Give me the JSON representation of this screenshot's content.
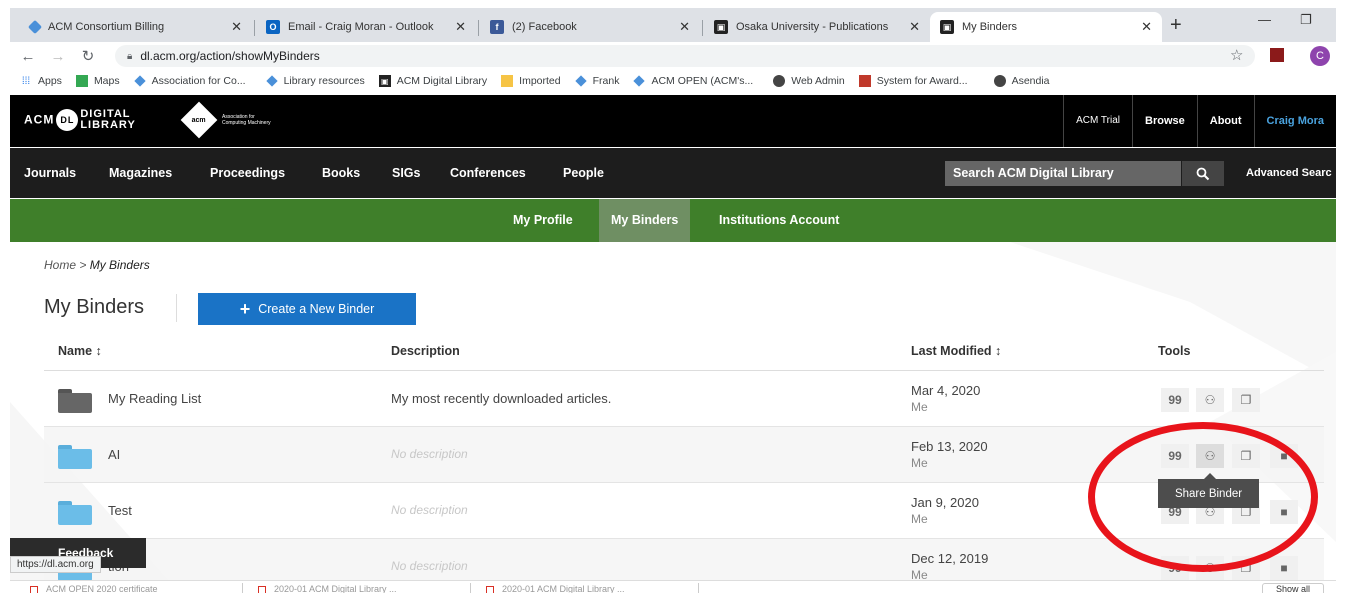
{
  "browser": {
    "tabs": [
      {
        "title": "ACM Consortium Billing",
        "icon": "acm-diamond-icon"
      },
      {
        "title": "Email - Craig Moran - Outlook",
        "icon": "outlook-icon"
      },
      {
        "title": "(2) Facebook",
        "icon": "facebook-icon"
      },
      {
        "title": "Osaka University - Publications",
        "icon": "acm-dl-icon"
      },
      {
        "title": "My Binders",
        "icon": "acm-dl-icon"
      }
    ],
    "active_tab": 4,
    "url": "dl.acm.org/action/showMyBinders",
    "profile_initial": "C",
    "bookmarks": [
      {
        "label": "Apps",
        "icon": "apps-grid-icon"
      },
      {
        "label": "Maps",
        "icon": "maps-icon"
      },
      {
        "label": "Association for Co...",
        "icon": "acm-diamond-icon"
      },
      {
        "label": "Library resources",
        "icon": "acm-diamond-icon"
      },
      {
        "label": "ACM Digital Library",
        "icon": "acm-dl-icon"
      },
      {
        "label": "Imported",
        "icon": "folder-icon"
      },
      {
        "label": "Frank",
        "icon": "acm-diamond-icon"
      },
      {
        "label": "ACM OPEN (ACM's...",
        "icon": "acm-diamond-icon"
      },
      {
        "label": "Web Admin",
        "icon": "globe-icon"
      },
      {
        "label": "System for Award...",
        "icon": "sam-icon"
      },
      {
        "label": "Asendia",
        "icon": "globe-icon"
      }
    ]
  },
  "header": {
    "logo_acm": "ACM",
    "logo_badge": "DL",
    "logo_digital": "DIGITAL",
    "logo_library": "LIBRARY",
    "org_badge": "acm",
    "org_line1": "Association for",
    "org_line2": "Computing Machinery",
    "top_links": [
      "ACM Trial",
      "Browse",
      "About",
      "Craig Mora"
    ]
  },
  "nav": {
    "items": [
      "Journals",
      "Magazines",
      "Proceedings",
      "Books",
      "SIGs",
      "Conferences",
      "People"
    ],
    "search_placeholder": "Search ACM Digital Library",
    "advanced_search": "Advanced Searc"
  },
  "subnav": {
    "items": [
      "My Profile",
      "My Binders",
      "Institutions Account"
    ],
    "active": 1
  },
  "page": {
    "breadcrumb_home": "Home",
    "breadcrumb_sep": ">",
    "breadcrumb_current": "My Binders",
    "title": "My Binders",
    "create_plus": "+",
    "create_label": "Create a New Binder",
    "columns": {
      "name": "Name ↕",
      "description": "Description",
      "last_modified": "Last Modified ↕",
      "tools": "Tools"
    },
    "binders": [
      {
        "name": "My Reading List",
        "description": "My most recently downloaded articles.",
        "date": "Mar 4, 2020",
        "by": "Me",
        "folder_color": "#666666",
        "empty": false
      },
      {
        "name": "AI",
        "description": "No description",
        "date": "Feb 13, 2020",
        "by": "Me",
        "folder_color": "#6bbde8",
        "empty": true
      },
      {
        "name": "Test",
        "description": "No description",
        "date": "Jan 9, 2020",
        "by": "Me",
        "folder_color": "#6bbde8",
        "empty": true
      },
      {
        "name": "tion",
        "description": "No description",
        "date": "Dec 12, 2019",
        "by": "Me",
        "folder_color": "#6bbde8",
        "empty": true
      }
    ],
    "tool_glyphs": {
      "cite": "99",
      "share": "⚇",
      "copy": "❐",
      "delete": "■"
    },
    "tooltip": "Share Binder"
  },
  "feedback_label": "Feedback",
  "status_url": "https://dl.acm.org",
  "downloads": {
    "items": [
      "ACM OPEN 2020 certificate",
      "2020-01 ACM Digital Library ...",
      "2020-01 ACM Digital Library ..."
    ],
    "show_all": "Show all"
  },
  "colors": {
    "green_bar": "#3f7f2a",
    "primary_button": "#1a73c6",
    "highlight_ring": "#e8141b"
  }
}
